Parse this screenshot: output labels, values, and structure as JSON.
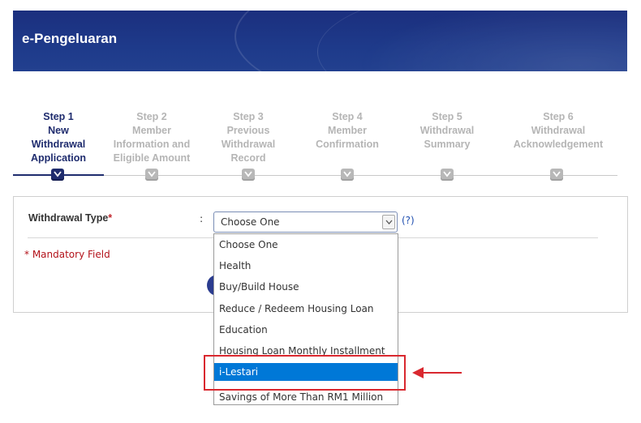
{
  "banner": {
    "title": "e-Pengeluaran"
  },
  "steps": [
    {
      "label": "Step 1\nNew\nWithdrawal\nApplication",
      "active": true
    },
    {
      "label": "Step 2\nMember\nInformation and\nEligible Amount",
      "active": false
    },
    {
      "label": "Step 3\nPrevious\nWithdrawal\nRecord",
      "active": false
    },
    {
      "label": "Step 4\nMember\nConfirmation",
      "active": false
    },
    {
      "label": "Step 5\nWithdrawal\nSummary",
      "active": false
    },
    {
      "label": "Step 6\nWithdrawal\nAcknowledgement",
      "active": false
    }
  ],
  "form": {
    "withdrawal_type_label": "Withdrawal Type",
    "required_mark": "*",
    "colon": ":",
    "select_value": "Choose One",
    "help_link": "(?)",
    "mandatory_mark": "*",
    "mandatory_text": " Mandatory Field"
  },
  "dropdown": {
    "options": [
      "Choose One",
      "Health",
      "Buy/Build House",
      "Reduce / Redeem Housing Loan",
      "Education",
      "Housing Loan Monthly Installment",
      "i-Lestari",
      "Savings of More Than RM1 Million"
    ],
    "selected": "i-Lestari"
  },
  "colors": {
    "brand_navy": "#1f2c6e",
    "banner_blue": "#1e3a8a",
    "selection_blue": "#0078d7",
    "annotation_red": "#d9282f",
    "mandatory_red": "#b3121a"
  }
}
